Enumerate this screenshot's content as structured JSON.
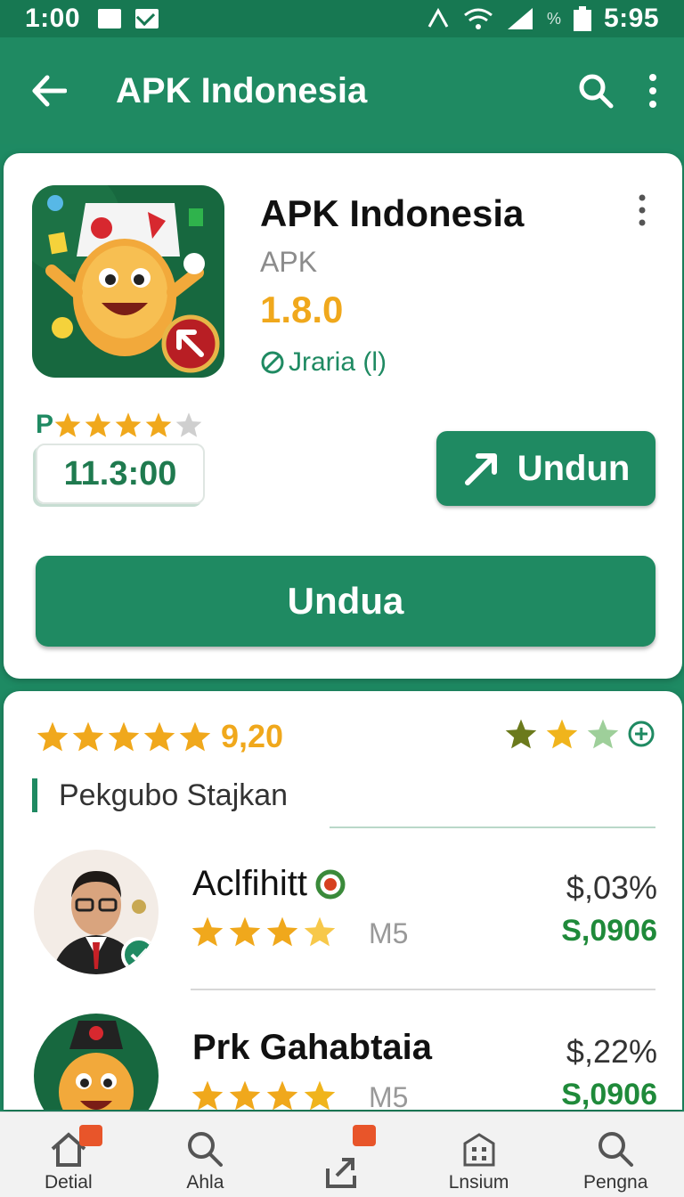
{
  "status": {
    "time": "1:00",
    "clock": "5:95"
  },
  "appbar": {
    "title": "APK Indonesia"
  },
  "app": {
    "name": "APK Indonesia",
    "type": "APK",
    "version": "1.8.0",
    "meta": "Jraria (l)",
    "rating_prefix": "P",
    "stars_filled": 4,
    "score": "11.3:00",
    "small_button": "Undun",
    "big_button": "Undua"
  },
  "summary": {
    "rating_text": "9,20",
    "section_title": "Pekgubo Stajkan"
  },
  "reviews": [
    {
      "name": "Aclfihitt",
      "tag": "M5",
      "pct": "$,03%",
      "money": "S,0906",
      "stars": 4
    },
    {
      "name": "Prk Gahabtaia",
      "tag": "M5",
      "pct": "$,22%",
      "money": "S,0906",
      "stars": 4
    }
  ],
  "nav": [
    {
      "label": "Detial",
      "icon": "home-icon"
    },
    {
      "label": "Ahla",
      "icon": "search-icon"
    },
    {
      "label": "",
      "icon": "share-icon"
    },
    {
      "label": "Lnsium",
      "icon": "building-icon"
    },
    {
      "label": "Pengna",
      "icon": "search-icon"
    }
  ],
  "colors": {
    "primary": "#1f8a62",
    "accent": "#f0a81c"
  }
}
